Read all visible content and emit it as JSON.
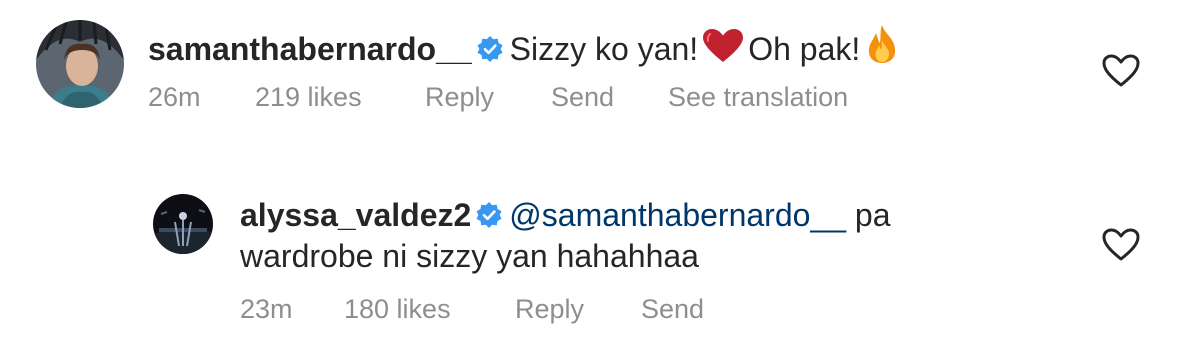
{
  "comments": [
    {
      "username": "samanthabernardo__",
      "verified": true,
      "text_part1": "Sizzy ko yan!",
      "text_part2": "Oh pak!",
      "emoji1": "red-heart",
      "emoji2": "fire",
      "time": "26m",
      "likes": "219 likes",
      "reply_label": "Reply",
      "send_label": "Send",
      "translate_label": "See translation"
    },
    {
      "username": "alyssa_valdez2",
      "verified": true,
      "mention": "@samanthabernardo__",
      "text_line1_rest": "pa",
      "text_line2": "wardrobe ni sizzy yan hahahhaa",
      "time": "23m",
      "likes": "180 likes",
      "reply_label": "Reply",
      "send_label": "Send"
    }
  ],
  "colors": {
    "text": "#262626",
    "meta": "#8e8e8e",
    "mention": "#00376b",
    "verified": "#3897f0",
    "heart_emoji": "#dd2e44",
    "fire_emoji": "#f4900c"
  }
}
